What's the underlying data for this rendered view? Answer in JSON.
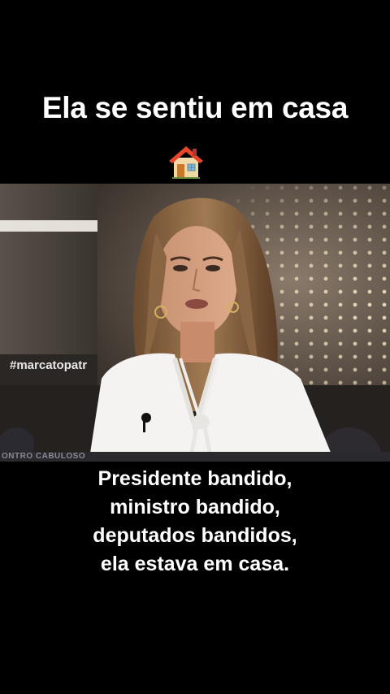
{
  "overlay": {
    "title": "Ela se sentiu em casa",
    "title_emoji": "house-emoji"
  },
  "video": {
    "hashtag": "#marcatopatr",
    "lower_strip_text": "ONTRO CABULOSO"
  },
  "subtitle": {
    "lines": [
      "Presidente bandido,",
      "ministro bandido,",
      "deputados bandidos,",
      "ela estava em casa."
    ]
  },
  "colors": {
    "background": "#000000",
    "text": "#ffffff",
    "house_roof": "#e8462b",
    "house_wall": "#f1d9a5"
  }
}
